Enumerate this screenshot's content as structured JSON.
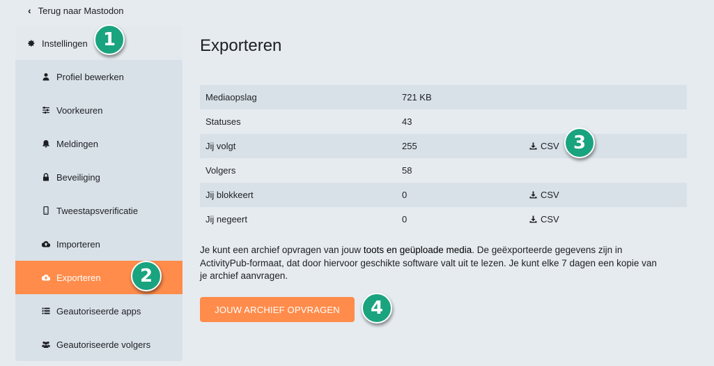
{
  "back_link": {
    "label": "Terug naar Mastodon",
    "icon": "chevron-left-icon"
  },
  "sidebar": {
    "items": [
      {
        "label": "Instellingen",
        "icon": "gear-icon"
      },
      {
        "label": "Profiel bewerken",
        "icon": "user-icon"
      },
      {
        "label": "Voorkeuren",
        "icon": "sliders-icon"
      },
      {
        "label": "Meldingen",
        "icon": "bell-icon"
      },
      {
        "label": "Beveiliging",
        "icon": "lock-icon"
      },
      {
        "label": "Tweestapsverificatie",
        "icon": "mobile-icon"
      },
      {
        "label": "Importeren",
        "icon": "cloud-upload-icon"
      },
      {
        "label": "Exporteren",
        "icon": "cloud-download-icon",
        "active": true
      },
      {
        "label": "Geautoriseerde apps",
        "icon": "list-icon"
      },
      {
        "label": "Geautoriseerde volgers",
        "icon": "users-icon"
      }
    ]
  },
  "main": {
    "title": "Exporteren",
    "table": {
      "rows": [
        {
          "label": "Mediaopslag",
          "value": "721 KB",
          "csv": ""
        },
        {
          "label": "Statuses",
          "value": "43",
          "csv": ""
        },
        {
          "label": "Jij volgt",
          "value": "255",
          "csv": "CSV"
        },
        {
          "label": "Volgers",
          "value": "58",
          "csv": ""
        },
        {
          "label": "Jij blokkeert",
          "value": "0",
          "csv": "CSV"
        },
        {
          "label": "Jij negeert",
          "value": "0",
          "csv": "CSV"
        }
      ]
    },
    "description": {
      "part1": "Je kunt een archief opvragen van jouw ",
      "strong": "toots en geüploade media",
      "part2": ". De geëxporteerde gegevens zijn in ActivityPub-formaat, dat door hiervoor geschikte software valt uit te lezen. Je kunt elke 7 dagen een kopie van je archief aanvragen."
    },
    "archive_button": "JOUW ARCHIEF OPVRAGEN"
  },
  "callouts": [
    "1",
    "2",
    "3",
    "4"
  ],
  "colors": {
    "accent": "#ff8c4b",
    "badge": "#1aa37f",
    "sidebar_bg": "#d9e1e8",
    "page_bg": "#e6ebf0"
  }
}
